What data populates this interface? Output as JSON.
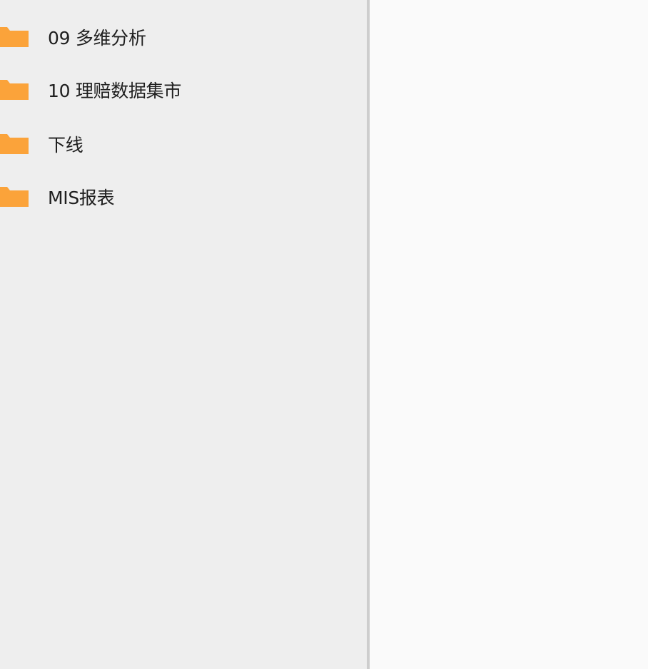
{
  "sidebar": {
    "folders": [
      {
        "label": "09 多维分析",
        "icon": "folder-icon"
      },
      {
        "label": "10 理赔数据集市",
        "icon": "folder-icon"
      },
      {
        "label": "下线",
        "icon": "folder-icon"
      },
      {
        "label": "MIS报表",
        "icon": "folder-icon"
      }
    ]
  },
  "colors": {
    "folder": "#fba33a",
    "sidebar_bg": "#eeeeee",
    "main_bg": "#fafafa",
    "divider": "#cdcdcd",
    "text": "#1e1e1e"
  }
}
